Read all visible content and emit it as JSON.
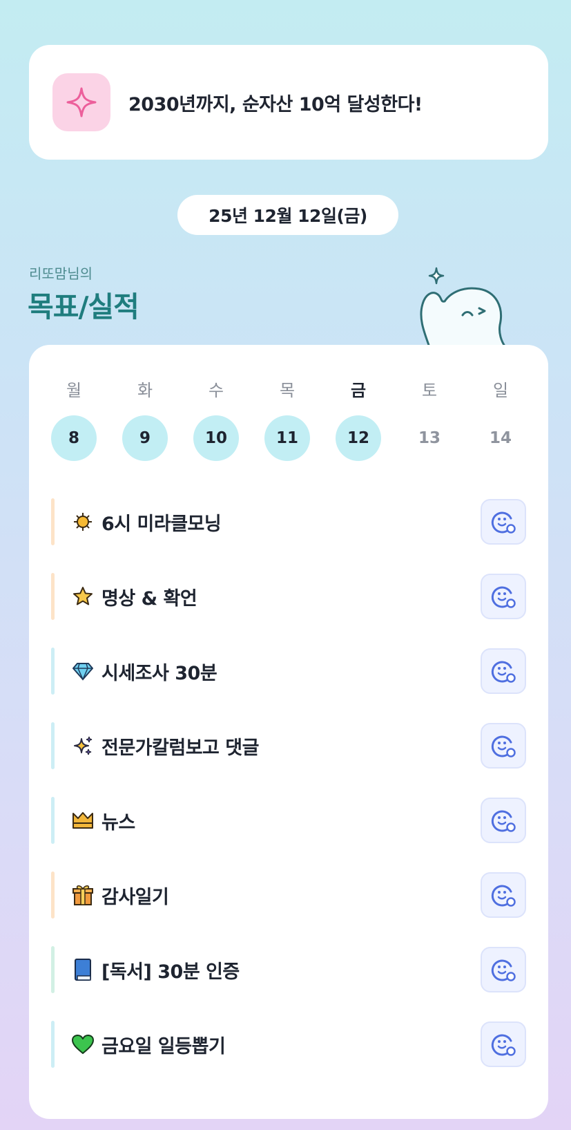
{
  "goal": {
    "text": "2030년까지, 순자산 10억 달성한다!",
    "icon": "sparkle-icon"
  },
  "date": {
    "label": "25년 12월 12일(금)"
  },
  "header": {
    "owner": "리또맘님의",
    "title": "목표/실적"
  },
  "week": {
    "days": [
      {
        "name": "월",
        "num": "8",
        "done": true
      },
      {
        "name": "화",
        "num": "9",
        "done": true
      },
      {
        "name": "수",
        "num": "10",
        "done": true
      },
      {
        "name": "목",
        "num": "11",
        "done": true
      },
      {
        "name": "금",
        "num": "12",
        "done": true,
        "today": true
      },
      {
        "name": "토",
        "num": "13",
        "done": false
      },
      {
        "name": "일",
        "num": "14",
        "done": false
      }
    ]
  },
  "tasks": [
    {
      "label": "6시 미라클모닝",
      "icon": "sun-icon",
      "bar_color": "#fde3c8"
    },
    {
      "label": "명상 & 확언",
      "icon": "star-icon",
      "bar_color": "#fde3c8"
    },
    {
      "label": "시세조사 30분",
      "icon": "diamond-icon",
      "bar_color": "#cdeef5"
    },
    {
      "label": "전문가칼럼보고 댓글",
      "icon": "sparkles-icon",
      "bar_color": "#cdeef5"
    },
    {
      "label": "뉴스",
      "icon": "crown-icon",
      "bar_color": "#cdeef5"
    },
    {
      "label": "감사일기",
      "icon": "gift-icon",
      "bar_color": "#fde3c8"
    },
    {
      "label": "[독서] 30분 인증",
      "icon": "book-icon",
      "bar_color": "#d2f0e4"
    },
    {
      "label": "금요일 일등뽑기",
      "icon": "heart-icon",
      "bar_color": "#cdeef5"
    }
  ],
  "colors": {
    "accent": "#1f7d7e",
    "done_day": "#c2eef4",
    "check_icon": "#4f6fe0"
  }
}
